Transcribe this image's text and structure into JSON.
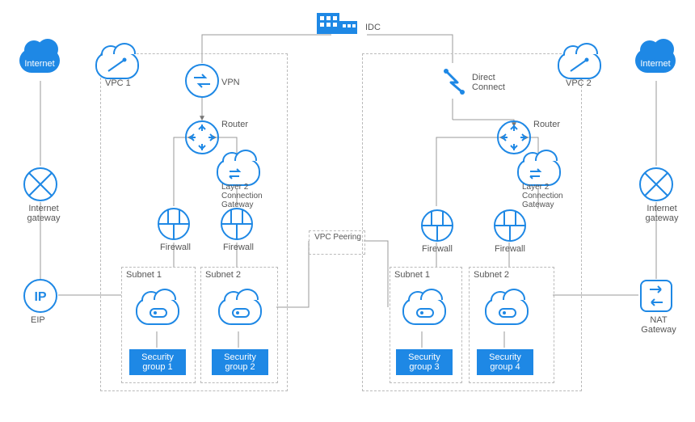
{
  "top": {
    "idc_label": "IDC",
    "internet_label": "Internet"
  },
  "left": {
    "internet_gateway_label": "Internet\ngateway",
    "eip_label": "EIP"
  },
  "right": {
    "internet_gateway_label": "Internet\ngateway",
    "nat_gateway_label": "NAT\nGateway"
  },
  "vpc1": {
    "label": "VPC 1",
    "vpn_label": "VPN",
    "router_label": "Router",
    "l2cg_label": "Layer 2\nConnection\nGateway",
    "firewall1_label": "Firewall",
    "firewall2_label": "Firewall",
    "subnet1_label": "Subnet 1",
    "subnet2_label": "Subnet 2",
    "sg1_label": "Security\ngroup 1",
    "sg2_label": "Security\ngroup 2"
  },
  "vpc2": {
    "label": "VPC 2",
    "direct_connect_label": "Direct\nConnect",
    "router_label": "Router",
    "l2cg_label": "Layer 2\nConnection\nGateway",
    "firewall1_label": "Firewall",
    "firewall2_label": "Firewall",
    "subnet1_label": "Subnet 1",
    "subnet2_label": "Subnet 2",
    "sg3_label": "Security\ngroup 3",
    "sg4_label": "Security\ngroup 4"
  },
  "peering": {
    "label": "VPC Peering"
  },
  "chart_data": {
    "type": "table",
    "title": "Network architecture diagram — two VPCs connected to an IDC and the public internet",
    "nodes": [
      {
        "id": "idc",
        "label": "IDC",
        "type": "datacenter"
      },
      {
        "id": "inet-left",
        "label": "Internet",
        "type": "internet"
      },
      {
        "id": "inet-right",
        "label": "Internet",
        "type": "internet"
      },
      {
        "id": "igw-left",
        "label": "Internet gateway",
        "type": "gateway"
      },
      {
        "id": "igw-right",
        "label": "Internet gateway",
        "type": "gateway"
      },
      {
        "id": "eip",
        "label": "EIP",
        "type": "eip"
      },
      {
        "id": "natgw",
        "label": "NAT Gateway",
        "type": "gateway"
      },
      {
        "id": "vpc1",
        "label": "VPC 1",
        "type": "vpc"
      },
      {
        "id": "vpc2",
        "label": "VPC 2",
        "type": "vpc"
      },
      {
        "id": "vpn",
        "label": "VPN",
        "type": "vpn",
        "parent": "vpc1"
      },
      {
        "id": "router1",
        "label": "Router",
        "type": "router",
        "parent": "vpc1"
      },
      {
        "id": "l2cg1",
        "label": "Layer 2 Connection Gateway",
        "type": "gateway",
        "parent": "vpc1"
      },
      {
        "id": "fw1a",
        "label": "Firewall",
        "type": "firewall",
        "parent": "vpc1"
      },
      {
        "id": "fw1b",
        "label": "Firewall",
        "type": "firewall",
        "parent": "vpc1"
      },
      {
        "id": "subnet1a",
        "label": "Subnet 1",
        "type": "subnet",
        "parent": "vpc1"
      },
      {
        "id": "subnet1b",
        "label": "Subnet 2",
        "type": "subnet",
        "parent": "vpc1"
      },
      {
        "id": "sg1",
        "label": "Security group 1",
        "type": "security-group",
        "parent": "subnet1a"
      },
      {
        "id": "sg2",
        "label": "Security group 2",
        "type": "security-group",
        "parent": "subnet1b"
      },
      {
        "id": "dc",
        "label": "Direct Connect",
        "type": "direct-connect",
        "parent": "vpc2"
      },
      {
        "id": "router2",
        "label": "Router",
        "type": "router",
        "parent": "vpc2"
      },
      {
        "id": "l2cg2",
        "label": "Layer 2 Connection Gateway",
        "type": "gateway",
        "parent": "vpc2"
      },
      {
        "id": "fw2a",
        "label": "Firewall",
        "type": "firewall",
        "parent": "vpc2"
      },
      {
        "id": "fw2b",
        "label": "Firewall",
        "type": "firewall",
        "parent": "vpc2"
      },
      {
        "id": "subnet2a",
        "label": "Subnet 1",
        "type": "subnet",
        "parent": "vpc2"
      },
      {
        "id": "subnet2b",
        "label": "Subnet 2",
        "type": "subnet",
        "parent": "vpc2"
      },
      {
        "id": "sg3",
        "label": "Security group 3",
        "type": "security-group",
        "parent": "subnet2a"
      },
      {
        "id": "sg4",
        "label": "Security group 4",
        "type": "security-group",
        "parent": "subnet2b"
      },
      {
        "id": "peering",
        "label": "VPC Peering",
        "type": "connection"
      }
    ],
    "edges": [
      {
        "from": "idc",
        "to": "vpn",
        "directed": false
      },
      {
        "from": "idc",
        "to": "dc",
        "directed": false
      },
      {
        "from": "inet-left",
        "to": "igw-left",
        "directed": false
      },
      {
        "from": "inet-right",
        "to": "igw-right",
        "directed": false
      },
      {
        "from": "igw-left",
        "to": "eip",
        "directed": false
      },
      {
        "from": "igw-right",
        "to": "natgw",
        "directed": false
      },
      {
        "from": "eip",
        "to": "subnet1a",
        "directed": false
      },
      {
        "from": "natgw",
        "to": "subnet2b",
        "directed": false
      },
      {
        "from": "vpn",
        "to": "router1",
        "directed": true,
        "direction": "to"
      },
      {
        "from": "dc",
        "to": "router2",
        "directed": true,
        "direction": "to"
      },
      {
        "from": "router1",
        "to": "fw1a",
        "directed": true,
        "direction": "from"
      },
      {
        "from": "router1",
        "to": "l2cg1",
        "directed": true,
        "direction": "from"
      },
      {
        "from": "l2cg1",
        "to": "fw1b",
        "directed": false
      },
      {
        "from": "fw1a",
        "to": "subnet1a",
        "directed": false
      },
      {
        "from": "fw1b",
        "to": "subnet1b",
        "directed": false
      },
      {
        "from": "router2",
        "to": "fw2a",
        "directed": true,
        "direction": "from"
      },
      {
        "from": "router2",
        "to": "l2cg2",
        "directed": true,
        "direction": "from"
      },
      {
        "from": "l2cg2",
        "to": "fw2b",
        "directed": false
      },
      {
        "from": "fw2a",
        "to": "subnet2a",
        "directed": false
      },
      {
        "from": "fw2b",
        "to": "subnet2b",
        "directed": false
      },
      {
        "from": "subnet1b",
        "to": "peering",
        "directed": false
      },
      {
        "from": "peering",
        "to": "subnet2a",
        "directed": false
      }
    ]
  }
}
